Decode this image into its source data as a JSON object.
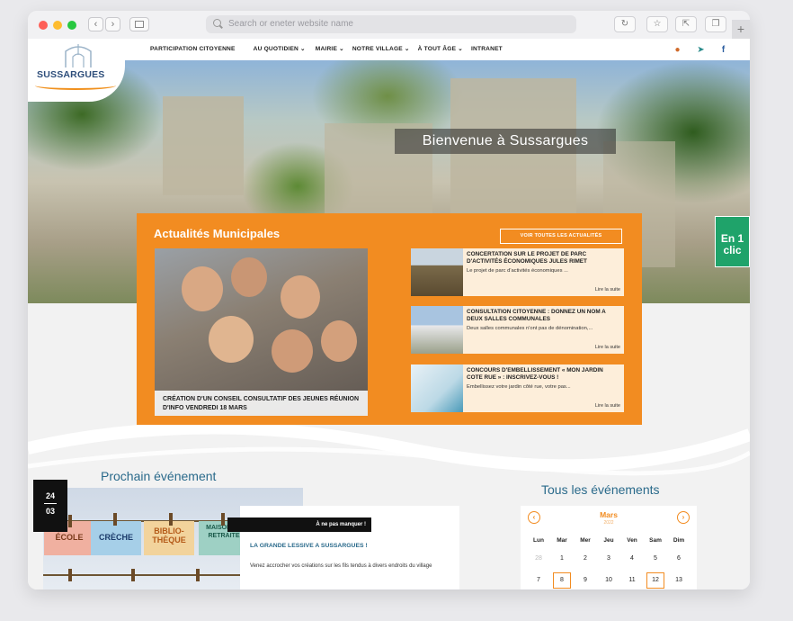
{
  "browser": {
    "url_placeholder": "Search or eneter website name",
    "back_icon": "chevron-left-icon",
    "forward_icon": "chevron-right-icon",
    "new_tab_label": "+"
  },
  "site": {
    "logo_text": "SUSSARGUES",
    "nav": [
      {
        "label": "PARTICIPATION CITOYENNE"
      },
      {
        "label": "AU QUOTIDIEN ⌄"
      },
      {
        "label": "MAIRIE ⌄"
      },
      {
        "label": "NOTRE VILLAGE ⌄"
      },
      {
        "label": "À TOUT ÂGE ⌄"
      },
      {
        "label": "INTRANET"
      }
    ],
    "header_icons": [
      "user-icon",
      "paper-plane-icon",
      "facebook-icon"
    ]
  },
  "hero": {
    "title": "Bienvenue à Sussargues"
  },
  "quick_access": {
    "label": "En 1 clic"
  },
  "news": {
    "title": "Actualités Municipales",
    "all_button": "VOIR TOUTES LES ACTUALITÉS",
    "featured": {
      "caption": "CRÉATION D'UN CONSEIL CONSULTATIF DES JEUNES RÉUNION D'INFO VENDREDI 18 MARS"
    },
    "items": [
      {
        "title": "CONCERTATION SUR LE PROJET DE PARC D'ACTIVITÉS ÉCONOMIQUES JULES RIMET",
        "excerpt": "Le projet de parc d'activités économiques ...",
        "more": "Lire la suite"
      },
      {
        "title": "CONSULTATION CITOYENNE : DONNEZ UN NOM A DEUX SALLES COMMUNALES",
        "excerpt": "Deux salles communales n'ont pas de dénomination,...",
        "more": "Lire la suite"
      },
      {
        "title": "CONCOURS D'EMBELLISSEMENT « MON JARDIN COTE RUE » : INSCRIVEZ-VOUS !",
        "excerpt": "Embellissez votre jardin côté rue, votre pas...",
        "more": "Lire la suite"
      }
    ]
  },
  "next_event": {
    "section_title": "Prochain événement",
    "day": "24",
    "month": "03",
    "ribbon": "À ne pas manquer !",
    "title": "LA GRANDE LESSIVE A SUSSARGUES !",
    "description": "Venez accrocher vos créations sur les fils tendus à divers endroits du village",
    "cards": [
      "ÉCOLE",
      "CRÈCHE",
      "BIBLIO-THÈQUE",
      "MAISON DE RETRAITE"
    ]
  },
  "calendar": {
    "section_title": "Tous les événements",
    "month": "Mars",
    "year": "2022",
    "days": [
      "Lun",
      "Mar",
      "Mer",
      "Jeu",
      "Ven",
      "Sam",
      "Dim"
    ],
    "rows": [
      [
        "28",
        "1",
        "2",
        "3",
        "4",
        "5",
        "6"
      ],
      [
        "7",
        "8",
        "9",
        "10",
        "11",
        "12",
        "13"
      ]
    ],
    "highlighted": [
      "8",
      "12"
    ],
    "accent": "#f28c21"
  },
  "colors": {
    "orange": "#f28c21",
    "navy": "#2d4d7a",
    "teal": "#2a6a8b",
    "green": "#1fa36a"
  }
}
